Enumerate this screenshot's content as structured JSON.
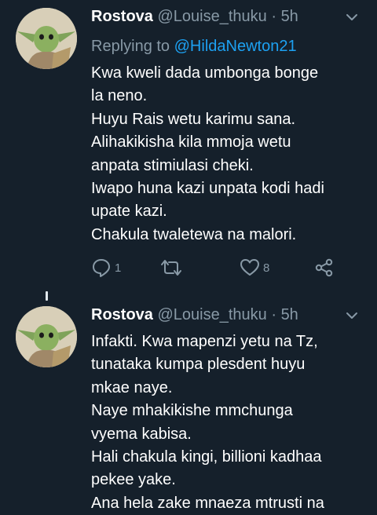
{
  "tweets": [
    {
      "name": "Rostova",
      "handle": "@Louise_thuku",
      "separator": "·",
      "time": "5h",
      "replying_prefix": "Replying to",
      "replying_mention": "@HildaNewton21",
      "lines": [
        "Kwa kweli dada umbonga bonge",
        "la neno.",
        "Huyu Rais wetu karimu sana.",
        "Alihakikisha kila mmoja wetu",
        "anpata stimiulasi cheki.",
        "Iwapo huna kazi unpata kodi hadi",
        "upate kazi.",
        "Chakula twaletewa na malori."
      ],
      "reply_count": "1",
      "retweet_count": "",
      "like_count": "8"
    },
    {
      "name": "Rostova",
      "handle": "@Louise_thuku",
      "separator": "·",
      "time": "5h",
      "lines": [
        "Infakti. Kwa mapenzi yetu na Tz,",
        "tunataka kumpa plesdent huyu",
        "mkae naye.",
        "Naye mhakikishe mmchunga",
        "vyema kabisa.",
        "Hali chakula kingi, billioni kadhaa",
        "pekee yake.",
        "Ana hela zake mnaeza mtrusti na"
      ]
    }
  ],
  "icons": {
    "reply": "reply-icon",
    "retweet": "retweet-icon",
    "like": "heart-icon",
    "share": "share-icon",
    "menu": "chevron-down-icon"
  },
  "colors": {
    "background": "#15202b",
    "secondary_text": "#8899a6",
    "accent": "#1da1f2",
    "primary_text": "#ffffff"
  }
}
